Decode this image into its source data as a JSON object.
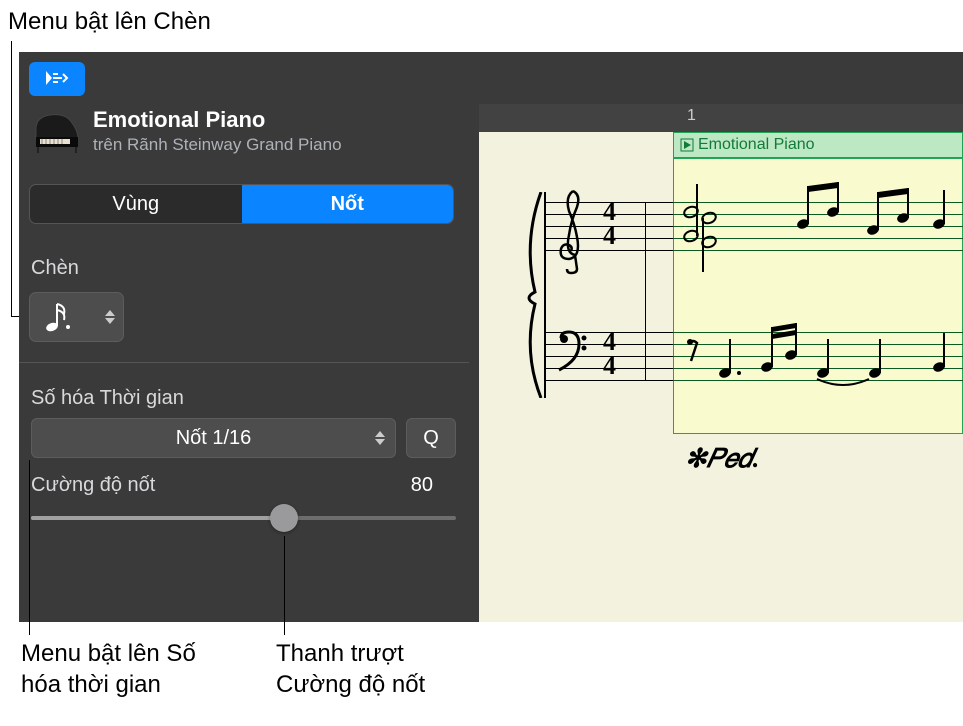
{
  "callouts": {
    "insert_menu": "Menu bật lên Chèn",
    "time_quantize_menu": "Menu bật lên Số hóa thời gian",
    "velocity_slider": "Thanh trượt Cường độ nốt"
  },
  "track": {
    "title": "Emotional Piano",
    "subtitle": "trên Rãnh Steinway Grand Piano"
  },
  "segmented": {
    "region": "Vùng",
    "note": "Nốt"
  },
  "insert": {
    "label": "Chèn",
    "icon_name": "sixteenth-note-icon"
  },
  "time_quantize": {
    "label": "Số hóa Thời gian",
    "value": "Nốt 1/16",
    "q_button": "Q"
  },
  "velocity": {
    "label": "Cường độ nốt",
    "value": "80"
  },
  "ruler": {
    "position": "1"
  },
  "region": {
    "name": "Emotional Piano"
  },
  "score": {
    "pedal_mark": "✻𝑃𝑒𝑑."
  }
}
